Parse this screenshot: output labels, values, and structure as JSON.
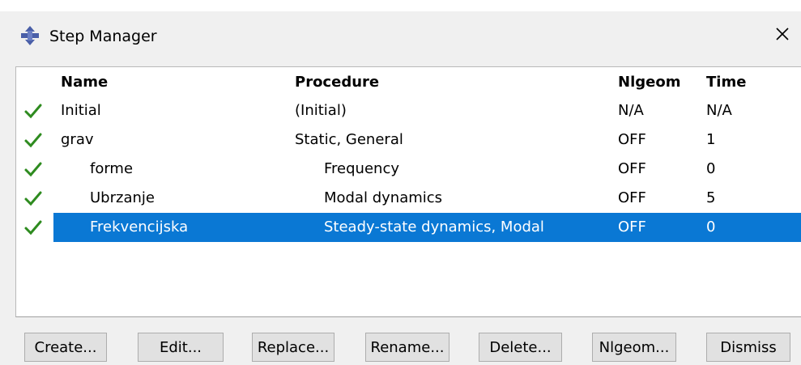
{
  "window": {
    "title": "Step Manager",
    "close_label": "✕"
  },
  "table": {
    "columns": [
      "Name",
      "Procedure",
      "Nlgeom",
      "Time"
    ],
    "rows": [
      {
        "name": "Initial",
        "procedure": "(Initial)",
        "nlgeom": "N/A",
        "time": "N/A",
        "status_icon": "check-icon"
      },
      {
        "name": "grav",
        "procedure": "Static, General",
        "nlgeom": "OFF",
        "time": "1",
        "status_icon": "check-icon"
      },
      {
        "name": "forme",
        "procedure": "Frequency",
        "nlgeom": "OFF",
        "time": "0",
        "status_icon": "check-icon"
      },
      {
        "name": "Ubrzanje",
        "procedure": "Modal dynamics",
        "nlgeom": "OFF",
        "time": "5",
        "status_icon": "check-icon"
      },
      {
        "name": "Frekvencijska",
        "procedure": "Steady-state dynamics, Modal",
        "nlgeom": "OFF",
        "time": "0",
        "status_icon": "check-icon",
        "selected": true
      }
    ]
  },
  "buttons": {
    "create": "Create...",
    "edit": "Edit...",
    "replace": "Replace...",
    "rename": "Rename...",
    "delete": "Delete...",
    "nlgeom": "Nlgeom...",
    "dismiss": "Dismiss"
  },
  "colors": {
    "selection": "#0a78d4",
    "check": "#2e8b1f",
    "app_icon": "#4a5fa8"
  }
}
